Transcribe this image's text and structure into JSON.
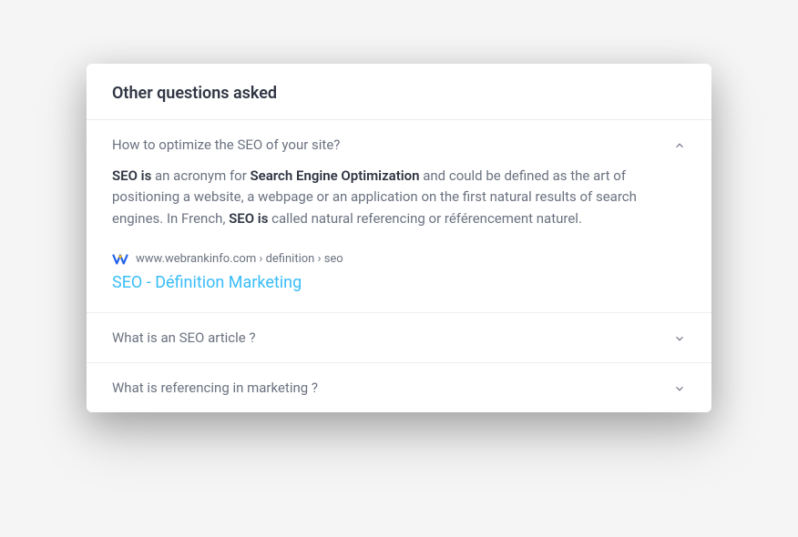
{
  "card": {
    "title": "Other questions asked"
  },
  "questions": [
    {
      "text": "How to optimize the SEO of your site?",
      "expanded": true,
      "answer": {
        "p1a": "SEO is",
        "p1b": " an acronym for ",
        "p1c": "Search Engine Optimization",
        "p1d": " and could be defined as the art of positioning a website, a webpage or an application on the first natural results of search engines. In French, ",
        "p1e": "SEO is",
        "p1f": " called natural referencing or référencement naturel."
      },
      "source": {
        "breadcrumb": "www.webrankinfo.com › definition › seo",
        "title": "SEO - Définition Marketing"
      }
    },
    {
      "text": "What is an SEO article ?",
      "expanded": false
    },
    {
      "text": "What is referencing in marketing ?",
      "expanded": false
    }
  ]
}
